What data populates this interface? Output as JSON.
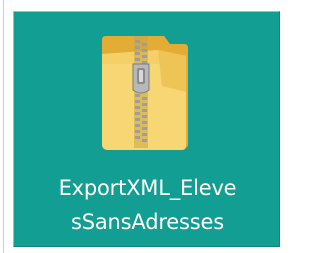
{
  "desktop_item": {
    "name_line_1": "ExportXML_Eleve",
    "name_line_2": "sSansAdresses",
    "icon": "zip-folder-icon",
    "selected": true
  },
  "colors": {
    "selection_fill": "#139e94",
    "label_text": "#ffffff",
    "folder_front": "#f5d471",
    "folder_back": "#e8b640",
    "zipper": "#9a9a9a"
  }
}
